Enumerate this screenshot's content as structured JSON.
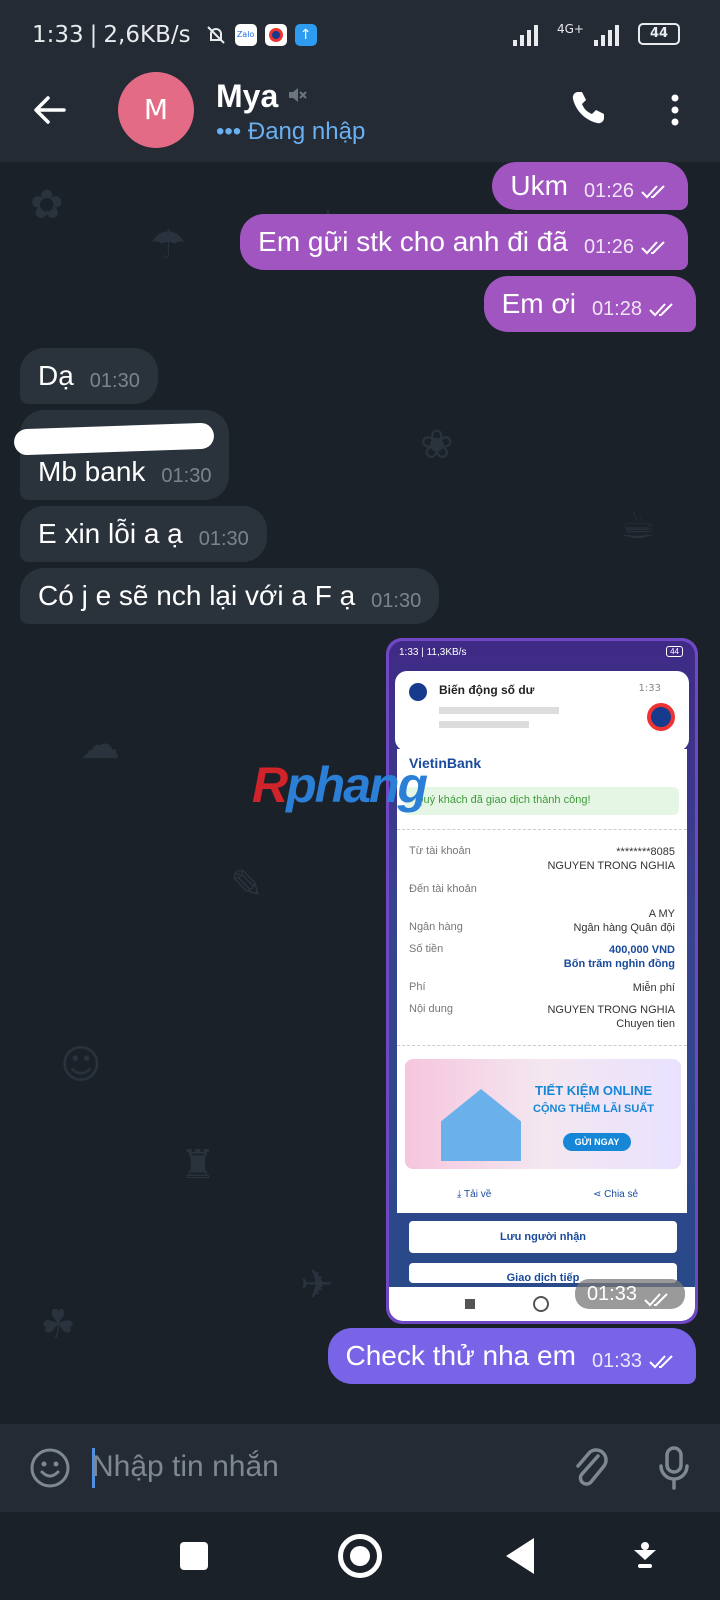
{
  "status_bar": {
    "time": "1:33",
    "speed": "2,6KB/s",
    "network": "4G+",
    "battery": "44",
    "app_icons": [
      "silent-icon",
      "zalo-icon",
      "bank-icon",
      "upload-icon"
    ],
    "zalo_label": "Zalo"
  },
  "header": {
    "avatar_letter": "M",
    "name": "Mya",
    "presence": "••• Đang nhập",
    "avatar_color": "#e46b86"
  },
  "messages": [
    {
      "dir": "out",
      "text": "Ukm",
      "time": "01:26"
    },
    {
      "dir": "out",
      "text": "Em gữi stk cho anh đi đã",
      "time": "01:26"
    },
    {
      "dir": "out",
      "text": "Em ơi",
      "time": "01:28"
    },
    {
      "dir": "in",
      "text": "Dạ",
      "time": "01:30"
    },
    {
      "dir": "in",
      "text": "Mb bank",
      "time": "01:30"
    },
    {
      "dir": "in",
      "text": "E xin lỗi a ạ",
      "time": "01:30"
    },
    {
      "dir": "in",
      "text": "Có j e sẽ nch lại với a F ạ",
      "time": "01:30"
    },
    {
      "dir": "out",
      "text": "Check thử nha em",
      "time": "01:33"
    }
  ],
  "image_message": {
    "time": "01:33",
    "status_bar": "1:33 | 11,3KB/s",
    "battery": "44",
    "notification": {
      "title": "Biến động số dư",
      "time": "1:33"
    },
    "receipt": {
      "brand": "VietinBank",
      "success": "Quý khách đã giao dịch thành công!",
      "rows": [
        {
          "label": "Từ tài khoản",
          "value": "********8085",
          "value2": "NGUYEN TRONG NGHIA"
        },
        {
          "label": "Đến tài khoản",
          "value": "",
          "value2": "A MY"
        },
        {
          "label": "Ngân hàng",
          "value": "Ngân hàng Quân đội",
          "value2": ""
        },
        {
          "label": "Số tiền",
          "value": "400,000 VND",
          "value2": "Bốn trăm nghìn đồng"
        },
        {
          "label": "Phí",
          "value": "Miễn phí",
          "value2": ""
        },
        {
          "label": "Nội dung",
          "value": "NGUYEN TRONG NGHIA",
          "value2": "Chuyen tien"
        }
      ],
      "promo_line1": "TIẾT KIỆM ONLINE",
      "promo_line2": "CỘNG THÊM LÃI SUẤT",
      "promo_button": "GỬI NGAY",
      "download": "Tải về",
      "share": "Chia sẻ",
      "save_recipient": "Lưu người nhận",
      "history": "Giao dịch tiếp"
    }
  },
  "watermark": "Rphang",
  "composer": {
    "placeholder": "Nhập tin nhắn"
  },
  "colors": {
    "outgoing_bubble": "#a155c0",
    "incoming_bubble": "#2a323c",
    "accent": "#6ab0f0"
  }
}
